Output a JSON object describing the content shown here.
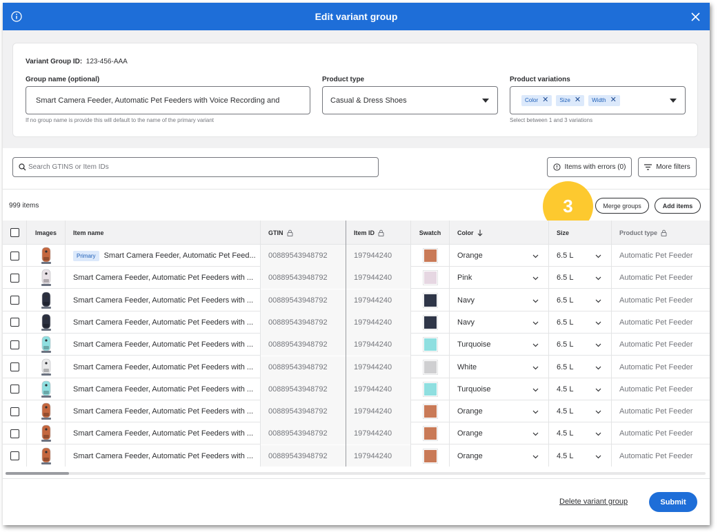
{
  "modal": {
    "title": "Edit variant group"
  },
  "group": {
    "id_label": "Variant Group ID:",
    "id_value": "123-456-AAA",
    "name_label": "Group name (optional)",
    "name_value": "Smart Camera Feeder, Automatic Pet Feeders with Voice Recording and",
    "name_help": "If no group name is provide this will default to the name of the primary variant",
    "product_type_label": "Product type",
    "product_type_value": "Casual & Dress Shoes",
    "variations_label": "Product variations",
    "variations": [
      "Color",
      "Size",
      "Width"
    ],
    "variations_help": "Select between 1 and 3 variations"
  },
  "toolbar": {
    "search_placeholder": "Search GTINS or Item IDs",
    "errors_button": "Items with errors (0)",
    "filters_button": "More filters",
    "item_count": "999 items",
    "merge_button": "Merge groups",
    "add_button": "Add items",
    "step_badge": "3"
  },
  "table": {
    "headers": {
      "images": "Images",
      "item_name": "Item name",
      "gtin": "GTIN",
      "item_id": "Item ID",
      "swatch": "Swatch",
      "color": "Color",
      "size": "Size",
      "product_type": "Product type"
    },
    "primary_label": "Primary",
    "rows": [
      {
        "primary": true,
        "name": "Smart Camera Feeder, Automatic Pet Feed...",
        "gtin": "00889543948792",
        "item_id": "197944240",
        "swatch": "#c97a57",
        "color": "Orange",
        "size": "6.5 L",
        "product_type": "Automatic Pet Feeder",
        "img": "orange"
      },
      {
        "primary": false,
        "name": "Smart Camera Feeder, Automatic Pet Feeders with ...",
        "gtin": "00889543948792",
        "item_id": "197944240",
        "swatch": "#e6d7e2",
        "color": "Pink",
        "size": "6.5 L",
        "product_type": "Automatic Pet Feeder",
        "img": "pink"
      },
      {
        "primary": false,
        "name": "Smart Camera Feeder, Automatic Pet Feeders with ...",
        "gtin": "00889543948792",
        "item_id": "197944240",
        "swatch": "#2f3648",
        "color": "Navy",
        "size": "6.5 L",
        "product_type": "Automatic Pet Feeder",
        "img": "navy"
      },
      {
        "primary": false,
        "name": "Smart Camera Feeder, Automatic Pet Feeders with ...",
        "gtin": "00889543948792",
        "item_id": "197944240",
        "swatch": "#2f3648",
        "color": "Navy",
        "size": "6.5 L",
        "product_type": "Automatic Pet Feeder",
        "img": "navy"
      },
      {
        "primary": false,
        "name": "Smart Camera Feeder, Automatic Pet Feeders with ...",
        "gtin": "00889543948792",
        "item_id": "197944240",
        "swatch": "#8fdfe0",
        "color": "Turquoise",
        "size": "6.5 L",
        "product_type": "Automatic Pet Feeder",
        "img": "turquoise"
      },
      {
        "primary": false,
        "name": "Smart Camera Feeder, Automatic Pet Feeders with ...",
        "gtin": "00889543948792",
        "item_id": "197944240",
        "swatch": "#cfcfd1",
        "color": "White",
        "size": "6.5 L",
        "product_type": "Automatic Pet Feeder",
        "img": "white"
      },
      {
        "primary": false,
        "name": "Smart Camera Feeder, Automatic Pet Feeders with ...",
        "gtin": "00889543948792",
        "item_id": "197944240",
        "swatch": "#8fdfe0",
        "color": "Turquoise",
        "size": "4.5 L",
        "product_type": "Automatic Pet Feeder",
        "img": "turquoise"
      },
      {
        "primary": false,
        "name": "Smart Camera Feeder, Automatic Pet Feeders with ...",
        "gtin": "00889543948792",
        "item_id": "197944240",
        "swatch": "#c97a57",
        "color": "Orange",
        "size": "4.5 L",
        "product_type": "Automatic Pet Feeder",
        "img": "orange"
      },
      {
        "primary": false,
        "name": "Smart Camera Feeder, Automatic Pet Feeders with ...",
        "gtin": "00889543948792",
        "item_id": "197944240",
        "swatch": "#c97a57",
        "color": "Orange",
        "size": "4.5 L",
        "product_type": "Automatic Pet Feeder",
        "img": "orange"
      },
      {
        "primary": false,
        "name": "Smart Camera Feeder, Automatic Pet Feeders with ...",
        "gtin": "00889543948792",
        "item_id": "197944240",
        "swatch": "#c97a57",
        "color": "Orange",
        "size": "4.5 L",
        "product_type": "Automatic Pet Feeder",
        "img": "orange"
      }
    ]
  },
  "footer": {
    "delete_link": "Delete variant group",
    "submit_button": "Submit"
  },
  "colors": {
    "accent": "#1e6ed8",
    "badge": "#fdc92f"
  }
}
